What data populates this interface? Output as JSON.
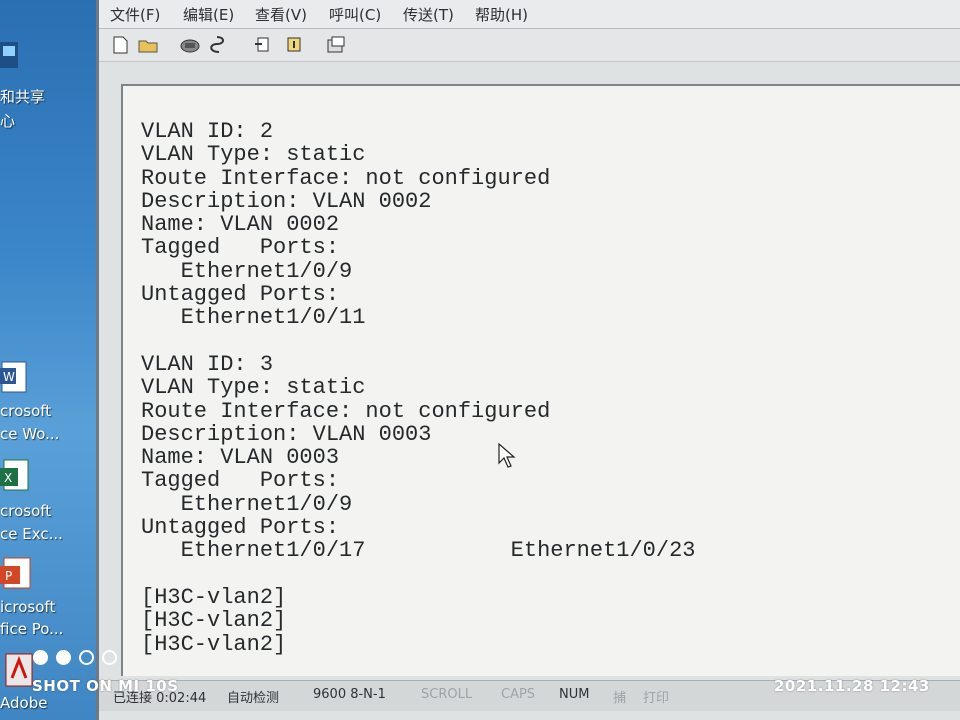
{
  "desktop": {
    "network_label_1": "和共享",
    "network_label_2": "心",
    "icons": [
      {
        "icon": "word-document-icon",
        "label_1": "crosoft",
        "label_2": "ce Wo..."
      },
      {
        "icon": "excel-spreadsheet-icon",
        "label_1": "crosoft",
        "label_2": "ce Exc..."
      },
      {
        "icon": "powerpoint-presentation-icon",
        "label_1": "icrosoft",
        "label_2": "fice Po..."
      },
      {
        "icon": "adobe-pdf-icon",
        "label_1": "Adobe"
      }
    ]
  },
  "window": {
    "menu": [
      {
        "label": "文件(F)"
      },
      {
        "label": "编辑(E)"
      },
      {
        "label": "查看(V)"
      },
      {
        "label": "呼叫(C)"
      },
      {
        "label": "传送(T)"
      },
      {
        "label": "帮助(H)"
      }
    ],
    "toolbar": [
      {
        "icon": "new-document-icon"
      },
      {
        "icon": "open-folder-icon"
      },
      {
        "icon": "connect-phone-icon"
      },
      {
        "icon": "disconnect-icon"
      },
      {
        "icon": "send-file-icon"
      },
      {
        "icon": "receive-file-icon"
      },
      {
        "icon": "properties-icon"
      }
    ]
  },
  "terminal": {
    "lines": [
      "VLAN ID: 2",
      "VLAN Type: static",
      "Route Interface: not configured",
      "Description: VLAN 0002",
      "Name: VLAN 0002",
      "Tagged   Ports:",
      "   Ethernet1/0/9",
      "Untagged Ports:",
      "   Ethernet1/0/11",
      "",
      "VLAN ID: 3",
      "VLAN Type: static",
      "Route Interface: not configured",
      "Description: VLAN 0003",
      "Name: VLAN 0003",
      "Tagged   Ports:",
      "   Ethernet1/0/9",
      "Untagged Ports:",
      "   Ethernet1/0/17           Ethernet1/0/23",
      "",
      "[H3C-vlan2]",
      "[H3C-vlan2]",
      "[H3C-vlan2]"
    ]
  },
  "status_bar": {
    "connection": "已连接 0:02:44",
    "detect": "自动检测",
    "port_settings": "9600 8-N-1",
    "scroll": "SCROLL",
    "caps": "CAPS",
    "num": "NUM",
    "capture": "捕",
    "print": "打印"
  },
  "watermark": {
    "camera": "SHOT ON MI 10S",
    "datetime": "2021.11.28 12:43"
  },
  "colors": {
    "desktop_blue": "#3b86c9",
    "terminal_bg": "#f3f3f1",
    "terminal_text": "#26292c"
  }
}
